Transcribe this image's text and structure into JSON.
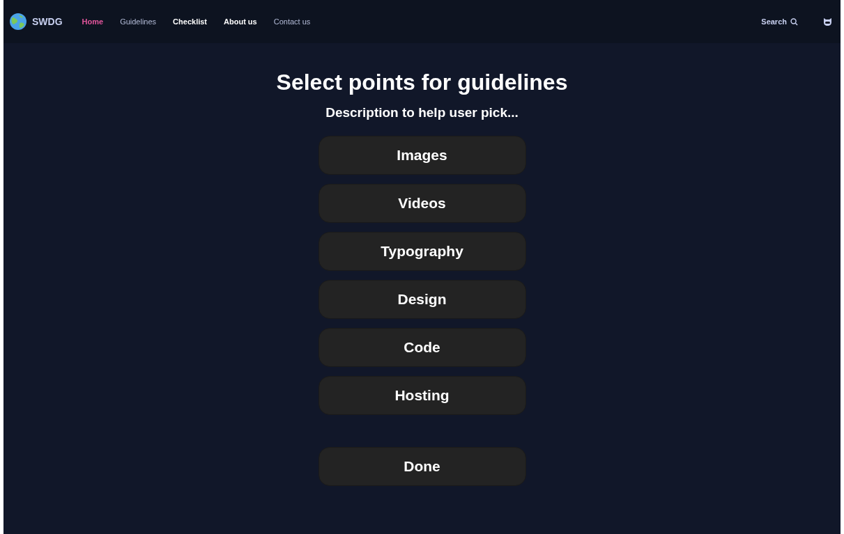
{
  "brand": {
    "name": "SWDG"
  },
  "nav": [
    {
      "label": "Home",
      "selected": true,
      "kind": "strong"
    },
    {
      "label": "Guidelines",
      "selected": false,
      "kind": "muted"
    },
    {
      "label": "Checklist",
      "selected": false,
      "kind": "strong"
    },
    {
      "label": "About us",
      "selected": false,
      "kind": "strong"
    },
    {
      "label": "Contact us",
      "selected": false,
      "kind": "muted"
    }
  ],
  "search": {
    "label": "Search"
  },
  "title": "Select points for guidelines",
  "subtitle": "Description to help user pick...",
  "options": [
    "Images",
    "Videos",
    "Typography",
    "Design",
    "Code",
    "Hosting"
  ],
  "done_button": "Done"
}
